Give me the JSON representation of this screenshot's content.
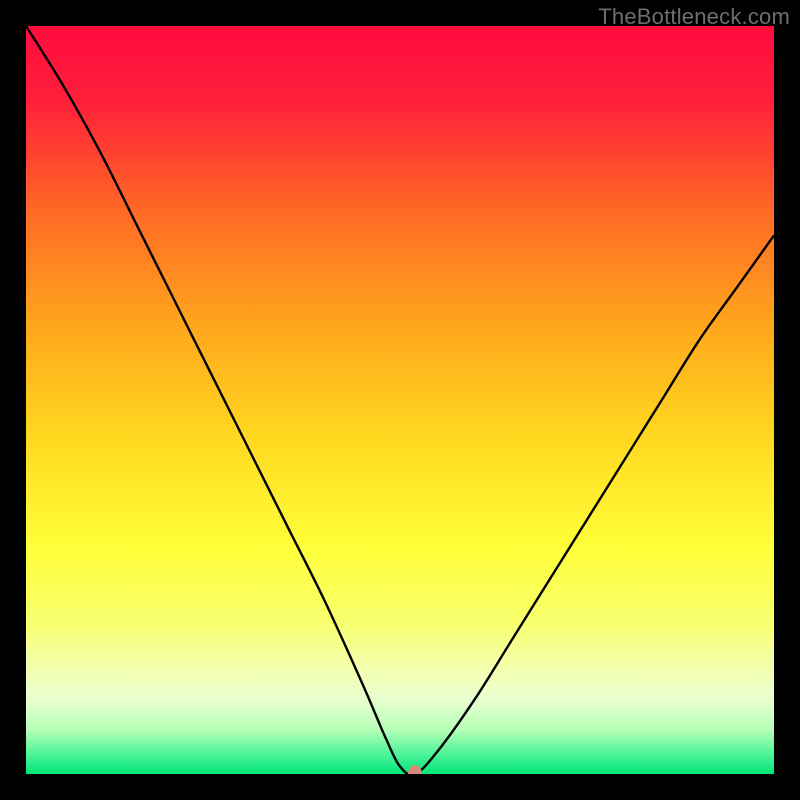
{
  "watermark": "TheBottleneck.com",
  "chart_data": {
    "type": "line",
    "title": "",
    "xlabel": "",
    "ylabel": "",
    "xlim": [
      0,
      100
    ],
    "ylim": [
      0,
      100
    ],
    "background_gradient": {
      "stops": [
        {
          "offset": 0.0,
          "color": "#ff0b3f"
        },
        {
          "offset": 0.1,
          "color": "#ff1f3a"
        },
        {
          "offset": 0.25,
          "color": "#ff6a25"
        },
        {
          "offset": 0.4,
          "color": "#ffa61c"
        },
        {
          "offset": 0.55,
          "color": "#ffd820"
        },
        {
          "offset": 0.7,
          "color": "#ffff3a"
        },
        {
          "offset": 0.8,
          "color": "#f7ff70"
        },
        {
          "offset": 0.86,
          "color": "#f3ffb0"
        },
        {
          "offset": 0.9,
          "color": "#e8ffd0"
        },
        {
          "offset": 0.94,
          "color": "#b8ffb8"
        },
        {
          "offset": 0.97,
          "color": "#58f59c"
        },
        {
          "offset": 1.0,
          "color": "#00e67a"
        }
      ]
    },
    "series": [
      {
        "name": "bottleneck-curve",
        "color": "#000000",
        "width": 2.4,
        "x": [
          0,
          5,
          10,
          15,
          20,
          25,
          30,
          35,
          40,
          45,
          48,
          50,
          52,
          55,
          60,
          65,
          70,
          75,
          80,
          85,
          90,
          95,
          100
        ],
        "y": [
          100,
          92,
          83,
          73,
          63,
          53,
          43,
          33,
          23,
          12,
          5,
          1,
          0,
          3,
          10,
          18,
          26,
          34,
          42,
          50,
          58,
          65,
          72
        ]
      }
    ],
    "marker": {
      "name": "optimal-point",
      "x": 52,
      "y": 0,
      "color": "#d88a7a",
      "rx": 7,
      "ry": 9
    }
  }
}
